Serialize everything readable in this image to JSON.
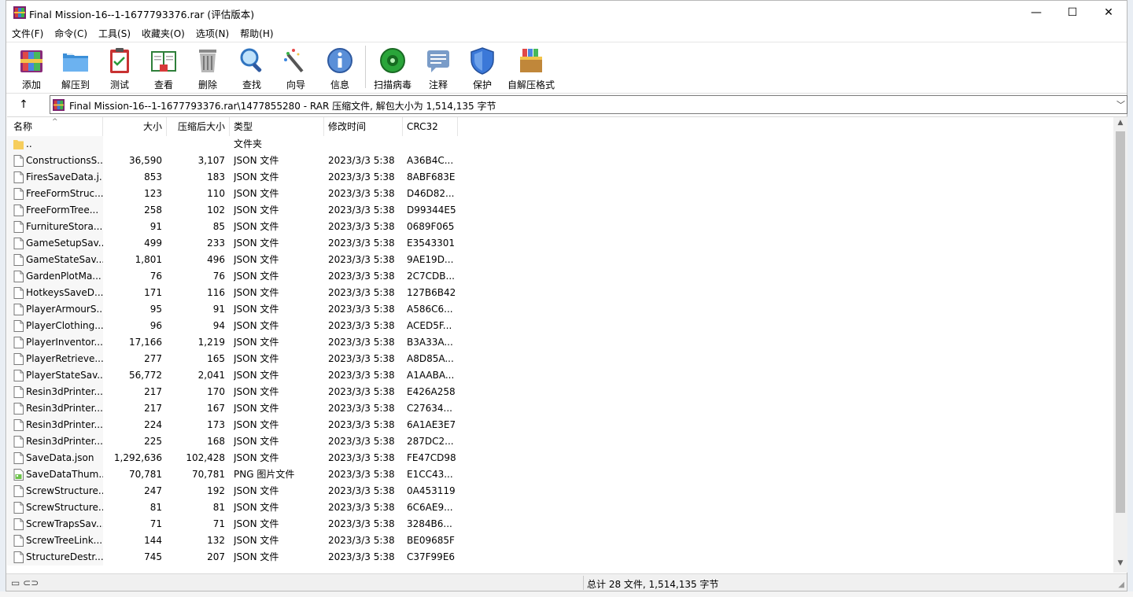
{
  "window": {
    "title": "Final Mission-16--1-1677793376.rar (评估版本)",
    "min_glyph": "—",
    "max_glyph": "☐",
    "close_glyph": "✕"
  },
  "menu": [
    "文件(F)",
    "命令(C)",
    "工具(S)",
    "收藏夹(O)",
    "选项(N)",
    "帮助(H)"
  ],
  "toolbar": [
    {
      "label": "添加",
      "icon": "add-archive-icon"
    },
    {
      "label": "解压到",
      "icon": "extract-folder-icon"
    },
    {
      "label": "测试",
      "icon": "test-clipboard-icon"
    },
    {
      "label": "查看",
      "icon": "view-book-icon"
    },
    {
      "label": "删除",
      "icon": "delete-trash-icon"
    },
    {
      "label": "查找",
      "icon": "find-magnifier-icon"
    },
    {
      "label": "向导",
      "icon": "wizard-wand-icon"
    },
    {
      "label": "信息",
      "icon": "info-icon"
    },
    {
      "label": "扫描病毒",
      "icon": "virus-scan-icon"
    },
    {
      "label": "注释",
      "icon": "comment-icon"
    },
    {
      "label": "保护",
      "icon": "shield-icon"
    },
    {
      "label": "自解压格式",
      "icon": "sfx-box-icon"
    }
  ],
  "address": {
    "up_glyph": "↑",
    "path": "Final Mission-16--1-1677793376.rar\\1477855280 - RAR 压缩文件, 解包大小为 1,514,135 字节",
    "drop_glyph": "﹀"
  },
  "columns": {
    "name": "名称",
    "size": "大小",
    "packed": "压缩后大小",
    "type": "类型",
    "modified": "修改时间",
    "crc": "CRC32",
    "sort_glyph": "^"
  },
  "files": [
    {
      "name": "..",
      "size": "",
      "packed": "",
      "type": "文件夹",
      "modified": "",
      "crc": "",
      "kind": "folder"
    },
    {
      "name": "ConstructionsS...",
      "size": "36,590",
      "packed": "3,107",
      "type": "JSON 文件",
      "modified": "2023/3/3 5:38",
      "crc": "A36B4C...",
      "kind": "file"
    },
    {
      "name": "FiresSaveData.j...",
      "size": "853",
      "packed": "183",
      "type": "JSON 文件",
      "modified": "2023/3/3 5:38",
      "crc": "8ABF683E",
      "kind": "file"
    },
    {
      "name": "FreeFormStruc...",
      "size": "123",
      "packed": "110",
      "type": "JSON 文件",
      "modified": "2023/3/3 5:38",
      "crc": "D46D82...",
      "kind": "file"
    },
    {
      "name": "FreeFormTree...",
      "size": "258",
      "packed": "102",
      "type": "JSON 文件",
      "modified": "2023/3/3 5:38",
      "crc": "D99344E5",
      "kind": "file"
    },
    {
      "name": "FurnitureStora...",
      "size": "91",
      "packed": "85",
      "type": "JSON 文件",
      "modified": "2023/3/3 5:38",
      "crc": "0689F065",
      "kind": "file"
    },
    {
      "name": "GameSetupSav...",
      "size": "499",
      "packed": "233",
      "type": "JSON 文件",
      "modified": "2023/3/3 5:38",
      "crc": "E3543301",
      "kind": "file"
    },
    {
      "name": "GameStateSav...",
      "size": "1,801",
      "packed": "496",
      "type": "JSON 文件",
      "modified": "2023/3/3 5:38",
      "crc": "9AE19D...",
      "kind": "file"
    },
    {
      "name": "GardenPlotMa...",
      "size": "76",
      "packed": "76",
      "type": "JSON 文件",
      "modified": "2023/3/3 5:38",
      "crc": "2C7CDB...",
      "kind": "file"
    },
    {
      "name": "HotkeysSaveD...",
      "size": "171",
      "packed": "116",
      "type": "JSON 文件",
      "modified": "2023/3/3 5:38",
      "crc": "127B6B42",
      "kind": "file"
    },
    {
      "name": "PlayerArmourS...",
      "size": "95",
      "packed": "91",
      "type": "JSON 文件",
      "modified": "2023/3/3 5:38",
      "crc": "A586C6...",
      "kind": "file"
    },
    {
      "name": "PlayerClothing...",
      "size": "96",
      "packed": "94",
      "type": "JSON 文件",
      "modified": "2023/3/3 5:38",
      "crc": "ACED5F...",
      "kind": "file"
    },
    {
      "name": "PlayerInventor...",
      "size": "17,166",
      "packed": "1,219",
      "type": "JSON 文件",
      "modified": "2023/3/3 5:38",
      "crc": "B3A33A...",
      "kind": "file"
    },
    {
      "name": "PlayerRetrieve...",
      "size": "277",
      "packed": "165",
      "type": "JSON 文件",
      "modified": "2023/3/3 5:38",
      "crc": "A8D85A...",
      "kind": "file"
    },
    {
      "name": "PlayerStateSav...",
      "size": "56,772",
      "packed": "2,041",
      "type": "JSON 文件",
      "modified": "2023/3/3 5:38",
      "crc": "A1AABA...",
      "kind": "file"
    },
    {
      "name": "Resin3dPrinter...",
      "size": "217",
      "packed": "170",
      "type": "JSON 文件",
      "modified": "2023/3/3 5:38",
      "crc": "E426A258",
      "kind": "file"
    },
    {
      "name": "Resin3dPrinter...",
      "size": "217",
      "packed": "167",
      "type": "JSON 文件",
      "modified": "2023/3/3 5:38",
      "crc": "C27634...",
      "kind": "file"
    },
    {
      "name": "Resin3dPrinter...",
      "size": "224",
      "packed": "173",
      "type": "JSON 文件",
      "modified": "2023/3/3 5:38",
      "crc": "6A1AE3E7",
      "kind": "file"
    },
    {
      "name": "Resin3dPrinter...",
      "size": "225",
      "packed": "168",
      "type": "JSON 文件",
      "modified": "2023/3/3 5:38",
      "crc": "287DC2...",
      "kind": "file"
    },
    {
      "name": "SaveData.json",
      "size": "1,292,636",
      "packed": "102,428",
      "type": "JSON 文件",
      "modified": "2023/3/3 5:38",
      "crc": "FE47CD98",
      "kind": "file"
    },
    {
      "name": "SaveDataThum...",
      "size": "70,781",
      "packed": "70,781",
      "type": "PNG 图片文件",
      "modified": "2023/3/3 5:38",
      "crc": "E1CC43...",
      "kind": "image"
    },
    {
      "name": "ScrewStructure...",
      "size": "247",
      "packed": "192",
      "type": "JSON 文件",
      "modified": "2023/3/3 5:38",
      "crc": "0A453119",
      "kind": "file"
    },
    {
      "name": "ScrewStructure...",
      "size": "81",
      "packed": "81",
      "type": "JSON 文件",
      "modified": "2023/3/3 5:38",
      "crc": "6C6AE9...",
      "kind": "file"
    },
    {
      "name": "ScrewTrapsSav...",
      "size": "71",
      "packed": "71",
      "type": "JSON 文件",
      "modified": "2023/3/3 5:38",
      "crc": "3284B6...",
      "kind": "file"
    },
    {
      "name": "ScrewTreeLink...",
      "size": "144",
      "packed": "132",
      "type": "JSON 文件",
      "modified": "2023/3/3 5:38",
      "crc": "BE09685F",
      "kind": "file"
    },
    {
      "name": "StructureDestr...",
      "size": "745",
      "packed": "207",
      "type": "JSON 文件",
      "modified": "2023/3/3 5:38",
      "crc": "C37F99E6",
      "kind": "file"
    }
  ],
  "status": {
    "icons_glyph": "▭ ⊂⊃",
    "text": "总计 28 文件, 1,514,135 字节",
    "grip_glyph": "◢"
  },
  "scroll": {
    "up_glyph": "▲",
    "down_glyph": "▼"
  },
  "colors": {
    "accent": "#0078d7",
    "folder": "#f6cd5c"
  }
}
